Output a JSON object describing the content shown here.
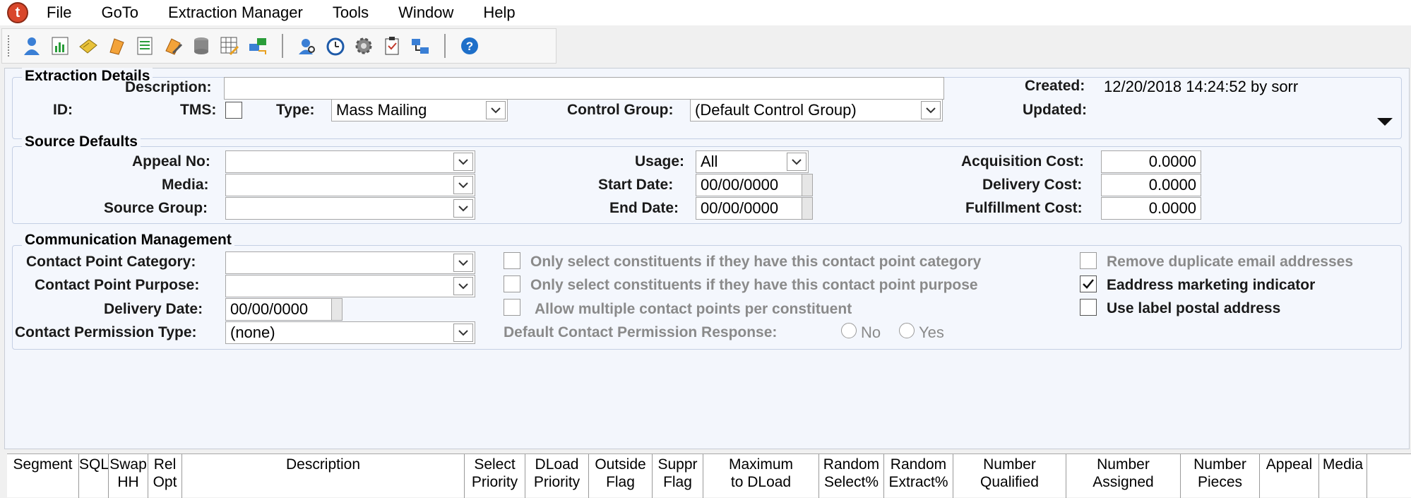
{
  "app": {
    "logo_letter": "t"
  },
  "menu": [
    "File",
    "GoTo",
    "Extraction Manager",
    "Tools",
    "Window",
    "Help"
  ],
  "toolbar": {
    "group1": [
      "constituent-icon",
      "report-icon",
      "ticket-icon",
      "flag-icon",
      "list-icon",
      "pencil-tag-icon",
      "database-icon",
      "grid-edit-icon",
      "transfer-icon"
    ],
    "group2": [
      "search-person-icon",
      "clock-icon",
      "gear-icon",
      "clipboard-icon",
      "network-icon"
    ],
    "group3": [
      "help-icon"
    ]
  },
  "extraction_details": {
    "title": "Extraction Details",
    "description_label": "Description:",
    "description_value": "",
    "id_label": "ID:",
    "tms_label": "TMS:",
    "tms_checked": false,
    "type_label": "Type:",
    "type_value": "Mass Mailing",
    "control_group_label": "Control Group:",
    "control_group_value": "(Default Control Group)",
    "created_label": "Created:",
    "created_value": "12/20/2018 14:24:52 by sorr",
    "updated_label": "Updated:",
    "updated_value": ""
  },
  "source_defaults": {
    "title": "Source Defaults",
    "appeal_label": "Appeal No:",
    "media_label": "Media:",
    "source_group_label": "Source Group:",
    "usage_label": "Usage:",
    "usage_value": "All",
    "start_date_label": "Start Date:",
    "start_date_value": "00/00/0000",
    "end_date_label": "End Date:",
    "end_date_value": "00/00/0000",
    "acq_cost_label": "Acquisition Cost:",
    "acq_cost_value": "0.0000",
    "delivery_cost_label": "Delivery Cost:",
    "delivery_cost_value": "0.0000",
    "fulfillment_cost_label": "Fulfillment Cost:",
    "fulfillment_cost_value": "0.0000"
  },
  "communication": {
    "title": "Communication Management",
    "cp_category_label": "Contact Point Category:",
    "cp_purpose_label": "Contact Point Purpose:",
    "delivery_date_label": "Delivery Date:",
    "delivery_date_value": "00/00/0000",
    "permission_type_label": "Contact Permission Type:",
    "permission_type_value": "(none)",
    "only_category_label": "Only select constituents if they have this contact point category",
    "only_purpose_label": "Only select constituents if they have this contact point purpose",
    "allow_multiple_label": "Allow multiple contact points per constituent",
    "default_response_label": "Default Contact Permission Response:",
    "radio_no": "No",
    "radio_yes": "Yes",
    "remove_dup_label": "Remove duplicate email addresses",
    "eaddress_label": "Eaddress marketing indicator",
    "eaddress_checked": true,
    "label_postal_label": "Use label postal address",
    "label_postal_checked": false
  },
  "grid": {
    "columns": [
      [
        "Segment"
      ],
      [
        "SQL"
      ],
      [
        "Swap",
        "HH"
      ],
      [
        "Rel",
        "Opt"
      ],
      [
        "Description"
      ],
      [
        "Select",
        "Priority"
      ],
      [
        "DLoad",
        "Priority"
      ],
      [
        "Outside",
        "Flag"
      ],
      [
        "Suppr",
        "Flag"
      ],
      [
        "Maximum",
        "to DLoad"
      ],
      [
        "Random",
        "Select%"
      ],
      [
        "Random",
        "Extract%"
      ],
      [
        "Number",
        "Qualified"
      ],
      [
        "Number",
        "Assigned"
      ],
      [
        "Number",
        "Pieces"
      ],
      [
        "Appeal"
      ],
      [
        "Media"
      ]
    ]
  }
}
